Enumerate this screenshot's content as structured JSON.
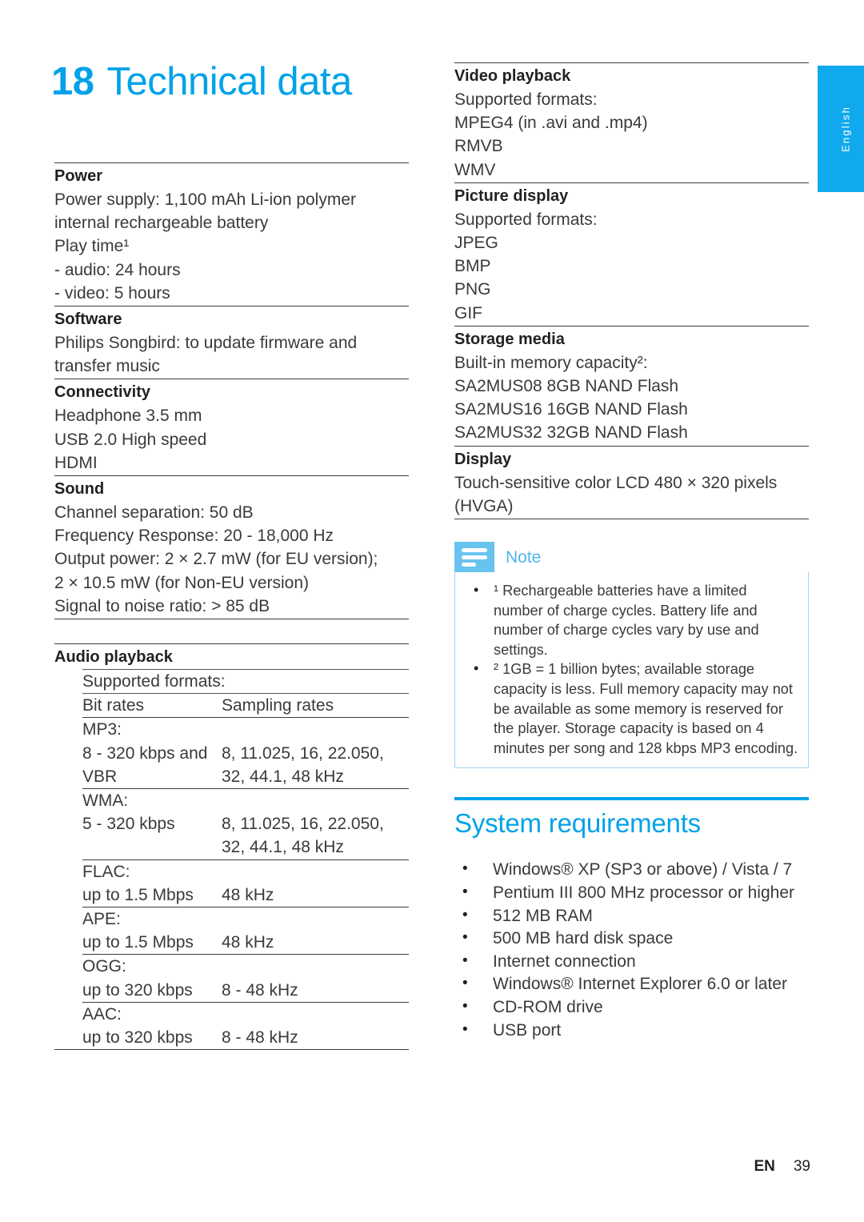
{
  "colors": {
    "brand_blue": "#00a2e8",
    "tab_blue": "#10a9ed",
    "note_icon_blue": "#69c3ef",
    "note_border_blue": "#9ed6f3",
    "text": "#3a3a3a"
  },
  "language_tab": {
    "label": "English"
  },
  "title": {
    "number": "18",
    "text": "Technical data"
  },
  "left_column": {
    "power": {
      "heading": "Power",
      "lines": [
        "Power supply: 1,100 mAh Li-ion polymer",
        "internal rechargeable battery",
        "Play time¹",
        "- audio: 24 hours",
        "- video: 5 hours"
      ]
    },
    "software": {
      "heading": "Software",
      "lines": [
        "Philips Songbird: to update firmware and",
        "transfer music"
      ]
    },
    "connectivity": {
      "heading": "Connectivity",
      "lines": [
        "Headphone 3.5 mm",
        "USB 2.0 High speed",
        "HDMI"
      ]
    },
    "sound": {
      "heading": "Sound",
      "lines": [
        "Channel separation: 50 dB",
        "Frequency Response: 20 - 18,000 Hz",
        "Output power: 2 × 2.7 mW (for EU version);",
        "2 × 10.5 mW (for Non-EU version)",
        "Signal to noise ratio: > 85 dB"
      ]
    },
    "audio_playback": {
      "heading": "Audio playback",
      "subheading": "Supported formats:",
      "col_headers": [
        "Bit rates",
        "Sampling rates"
      ],
      "rows": [
        {
          "format": "MP3:",
          "bitrate": [
            "8 - 320 kbps and",
            "VBR"
          ],
          "sampling": [
            "8, 11.025, 16, 22.050,",
            "32, 44.1, 48 kHz"
          ]
        },
        {
          "format": "WMA:",
          "bitrate": [
            "5 - 320 kbps"
          ],
          "sampling": [
            "8, 11.025, 16, 22.050,",
            "32, 44.1, 48 kHz"
          ]
        },
        {
          "format": "FLAC:",
          "bitrate": [
            "up to 1.5 Mbps"
          ],
          "sampling": [
            "48 kHz"
          ]
        },
        {
          "format": "APE:",
          "bitrate": [
            "up to 1.5 Mbps"
          ],
          "sampling": [
            "48 kHz"
          ]
        },
        {
          "format": "OGG:",
          "bitrate": [
            "up to 320 kbps"
          ],
          "sampling": [
            "8 - 48 kHz"
          ]
        },
        {
          "format": "AAC:",
          "bitrate": [
            "up to 320 kbps"
          ],
          "sampling": [
            "8 - 48 kHz"
          ]
        }
      ]
    }
  },
  "right_column": {
    "video_playback": {
      "heading": "Video playback",
      "lines": [
        "Supported formats:",
        "MPEG4 (in .avi and .mp4)",
        "RMVB",
        "WMV"
      ]
    },
    "picture_display": {
      "heading": "Picture display",
      "lines": [
        "Supported formats:",
        "JPEG",
        "BMP",
        "PNG",
        "GIF"
      ]
    },
    "storage_media": {
      "heading": "Storage media",
      "lines": [
        "Built-in memory capacity²:",
        "SA2MUS08 8GB NAND Flash",
        "SA2MUS16 16GB NAND Flash",
        "SA2MUS32 32GB NAND Flash"
      ]
    },
    "display": {
      "heading": "Display",
      "lines": [
        "Touch-sensitive color LCD 480 × 320 pixels",
        "(HVGA)"
      ]
    },
    "note": {
      "title": "Note",
      "items": [
        "¹ Rechargeable batteries have a limited number of charge cycles. Battery life and number of charge cycles vary by use and settings.",
        "² 1GB = 1 billion bytes; available storage capacity is less. Full memory capacity may not be available as some memory is reserved for the player. Storage capacity is based on 4 minutes per song and 128 kbps MP3 encoding."
      ]
    },
    "system_requirements": {
      "title": "System requirements",
      "items": [
        "Windows® XP (SP3 or above) / Vista / 7",
        "Pentium III 800 MHz processor or higher",
        "512 MB RAM",
        "500 MB hard disk space",
        "Internet connection",
        "Windows® Internet Explorer 6.0 or later",
        "CD-ROM drive",
        "USB port"
      ]
    }
  },
  "footer": {
    "language_code": "EN",
    "page_number": "39"
  }
}
